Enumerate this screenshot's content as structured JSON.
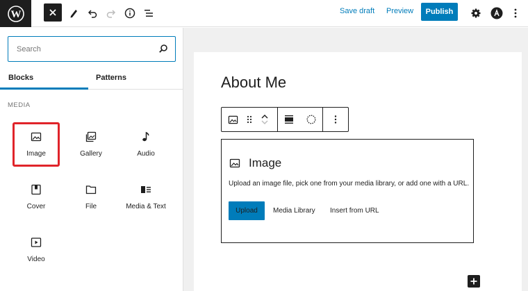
{
  "header": {
    "save_draft": "Save draft",
    "preview": "Preview",
    "publish": "Publish"
  },
  "sidebar": {
    "search_placeholder": "Search",
    "tabs": [
      {
        "label": "Blocks",
        "active": true
      },
      {
        "label": "Patterns",
        "active": false
      }
    ],
    "category": "MEDIA",
    "blocks": [
      {
        "label": "Image",
        "icon": "image-icon",
        "selected": true
      },
      {
        "label": "Gallery",
        "icon": "gallery-icon"
      },
      {
        "label": "Audio",
        "icon": "audio-icon"
      },
      {
        "label": "Cover",
        "icon": "cover-icon"
      },
      {
        "label": "File",
        "icon": "file-icon"
      },
      {
        "label": "Media & Text",
        "icon": "media-text-icon"
      },
      {
        "label": "Video",
        "icon": "video-icon"
      }
    ]
  },
  "editor": {
    "heading": "About Me",
    "image_block": {
      "title": "Image",
      "instructions": "Upload an image file, pick one from your media library, or add one with a URL.",
      "upload": "Upload",
      "media_library": "Media Library",
      "insert_url": "Insert from URL"
    }
  },
  "colors": {
    "accent": "#007cba",
    "highlight": "#e0242a",
    "dark": "#1e1e1e"
  }
}
